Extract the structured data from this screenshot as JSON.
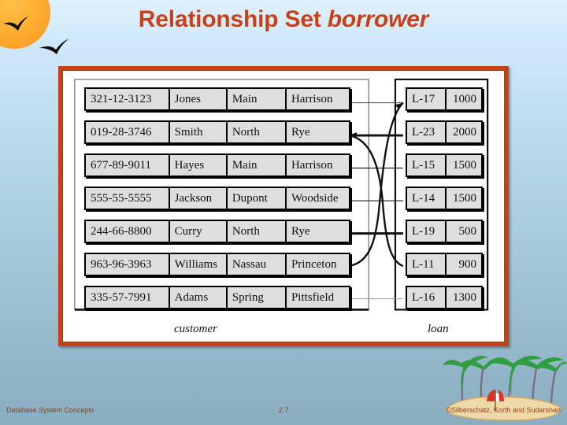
{
  "title": {
    "main": "Relationship Set ",
    "emphasis": "borrower"
  },
  "figure": {
    "customer_caption": "customer",
    "loan_caption": "loan",
    "customer_rows": [
      {
        "ssn": "321-12-3123",
        "name": "Jones",
        "street": "Main",
        "city": "Harrison"
      },
      {
        "ssn": "019-28-3746",
        "name": "Smith",
        "street": "North",
        "city": "Rye"
      },
      {
        "ssn": "677-89-9011",
        "name": "Hayes",
        "street": "Main",
        "city": "Harrison"
      },
      {
        "ssn": "555-55-5555",
        "name": "Jackson",
        "street": "Dupont",
        "city": "Woodside"
      },
      {
        "ssn": "244-66-8800",
        "name": "Curry",
        "street": "North",
        "city": "Rye"
      },
      {
        "ssn": "963-96-3963",
        "name": "Williams",
        "street": "Nassau",
        "city": "Princeton"
      },
      {
        "ssn": "335-57-7991",
        "name": "Adams",
        "street": "Spring",
        "city": "Pittsfield"
      }
    ],
    "loan_rows": [
      {
        "number": "L-17",
        "amount": "1000"
      },
      {
        "number": "L-23",
        "amount": "2000"
      },
      {
        "number": "L-15",
        "amount": "1500"
      },
      {
        "number": "L-14",
        "amount": "1500"
      },
      {
        "number": "L-19",
        "amount": "500"
      },
      {
        "number": "L-11",
        "amount": "900"
      },
      {
        "number": "L-16",
        "amount": "1300"
      }
    ]
  },
  "footer": {
    "left": "Database System Concepts",
    "center": "2.7",
    "right": "©Silberschatz, Korth and Sudarshan"
  },
  "colors": {
    "title": "#c8401a",
    "frame": "#c8401a",
    "cell_fill": "#dedede",
    "sun": "#ffb033"
  }
}
